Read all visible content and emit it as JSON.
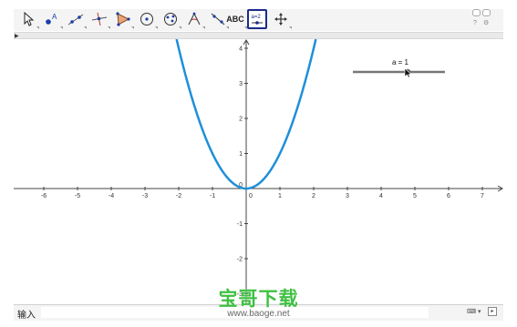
{
  "toolbar": {
    "tools": [
      {
        "name": "move-tool",
        "icon": "cursor-arrow-icon"
      },
      {
        "name": "point-tool",
        "icon": "point-icon",
        "label": "A"
      },
      {
        "name": "line-tool",
        "icon": "line-icon"
      },
      {
        "name": "perpendicular-line-tool",
        "icon": "perpendicular-icon"
      },
      {
        "name": "polygon-tool",
        "icon": "polygon-icon"
      },
      {
        "name": "circle-tool",
        "icon": "circle-center-icon"
      },
      {
        "name": "ellipse-tool",
        "icon": "ellipse-icon"
      },
      {
        "name": "angle-tool",
        "icon": "angle-icon"
      },
      {
        "name": "reflect-tool",
        "icon": "reflect-icon"
      },
      {
        "name": "text-tool",
        "icon": "text-icon",
        "label": "ABC"
      },
      {
        "name": "slider-tool",
        "icon": "slider-icon",
        "label": "a=2"
      },
      {
        "name": "move-graphics-view-tool",
        "icon": "move-view-icon"
      }
    ],
    "help": "?",
    "settings": "⚙"
  },
  "graphics": {
    "x_ticks": [
      "-6",
      "-5",
      "-4",
      "-3",
      "-2",
      "-1",
      "0",
      "1",
      "2",
      "3",
      "4",
      "5",
      "6",
      "7"
    ],
    "y_ticks_pos": [
      "1",
      "2",
      "3",
      "4"
    ],
    "y_ticks_neg": [
      "-1",
      "-2",
      "-3"
    ],
    "function": "a x^2",
    "curve_color": "#1f8fd9"
  },
  "slider": {
    "label": "a = 1",
    "value": 1,
    "min": -5,
    "max": 5
  },
  "input_bar": {
    "label": "输入",
    "value": "",
    "keyboard_icon": "keyboard-icon",
    "expand_icon": "expand-icon"
  },
  "watermark": {
    "title": "宝哥下载",
    "url": "www.baoge.net"
  }
}
